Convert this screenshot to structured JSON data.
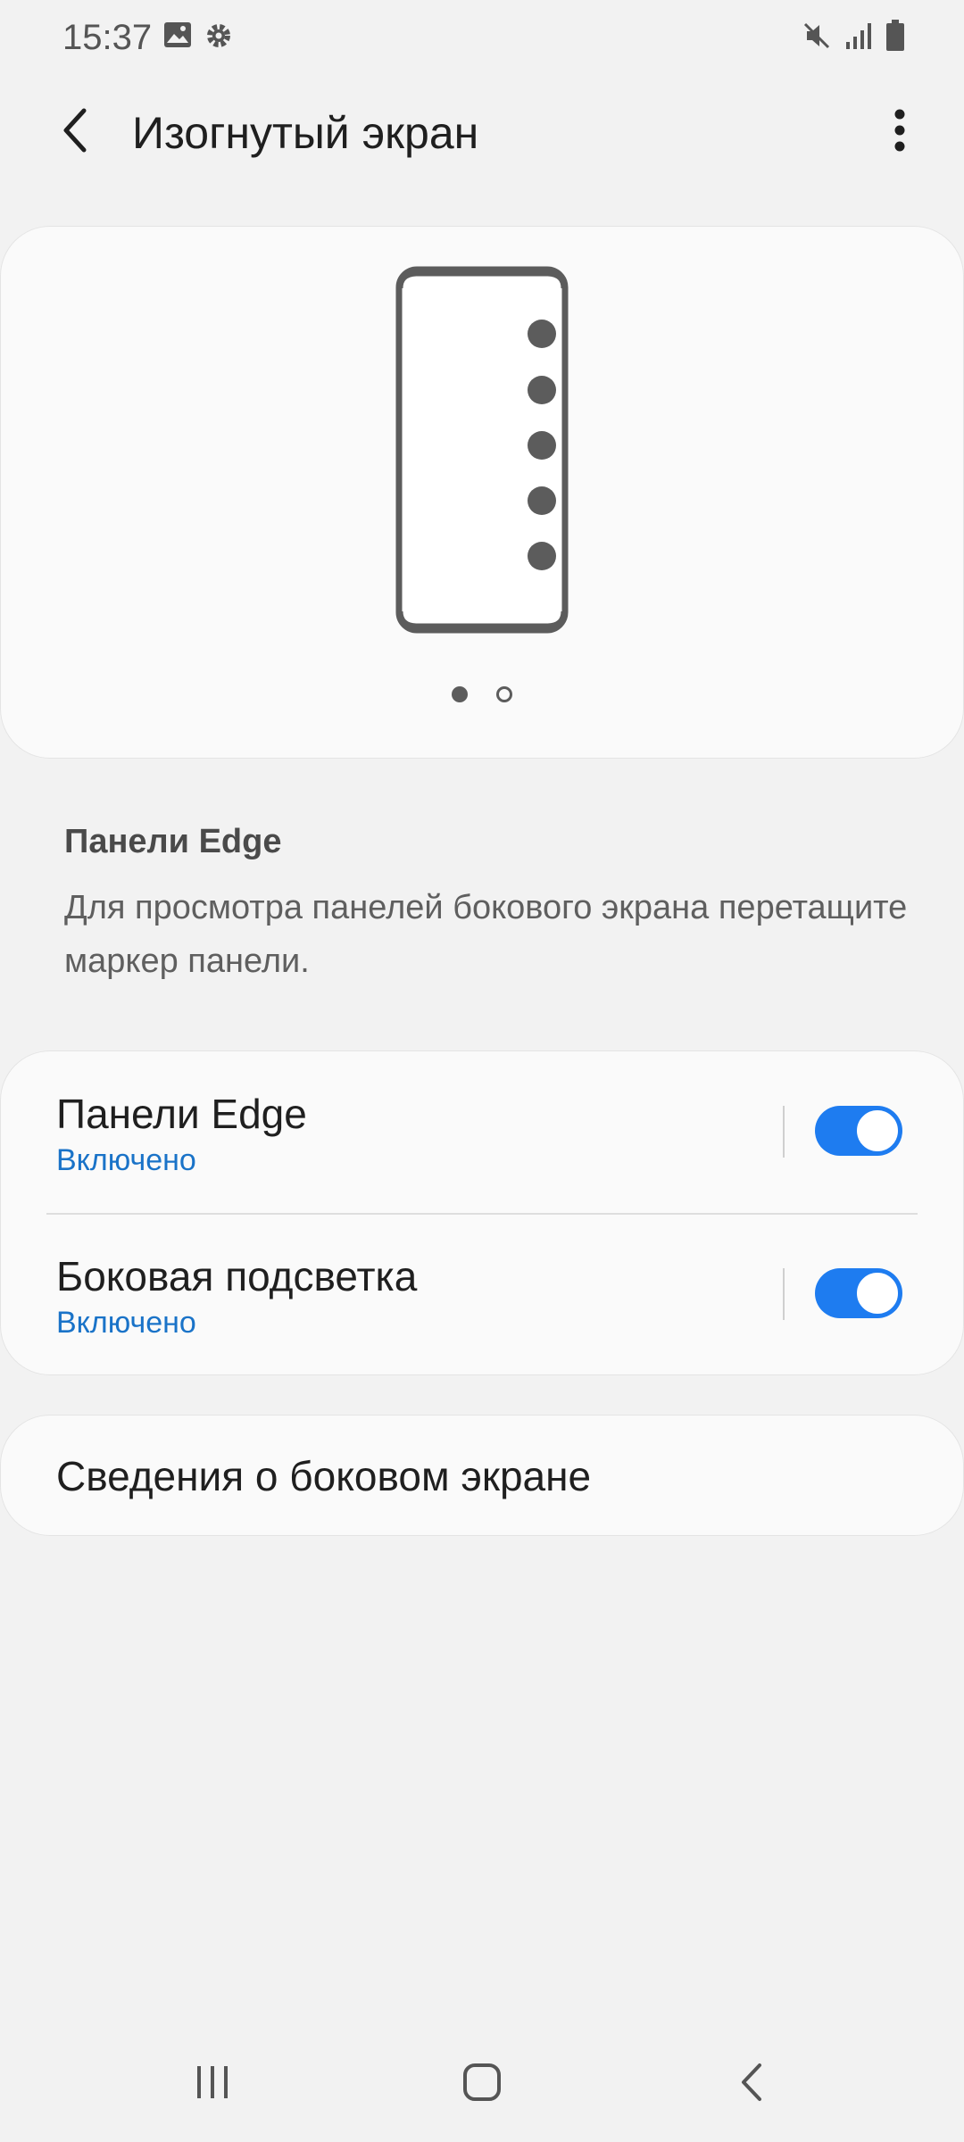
{
  "status_bar": {
    "time": "15:37",
    "left_icons": [
      "image-icon",
      "gear-icon"
    ],
    "right_icons": [
      "mute-icon",
      "signal-icon",
      "battery-icon"
    ]
  },
  "header": {
    "title": "Изогнутый экран",
    "back_icon": "chevron-left-icon",
    "more_icon": "more-vertical-icon"
  },
  "preview": {
    "pages_total": 2,
    "active_page": 1
  },
  "description": {
    "title": "Панели Edge",
    "text": "Для просмотра панелей бокового экрана перетащите маркер панели."
  },
  "settings": [
    {
      "title": "Панели Edge",
      "status": "Включено",
      "enabled": true
    },
    {
      "title": "Боковая подсветка",
      "status": "Включено",
      "enabled": true
    }
  ],
  "about": {
    "label": "Сведения о боковом экране"
  },
  "colors": {
    "accent": "#1e7cf0",
    "status_text": "#1a73c8",
    "background": "#f2f2f2",
    "card": "#fafafa"
  },
  "nav_bar": [
    "recent-apps-icon",
    "home-icon",
    "back-icon"
  ]
}
